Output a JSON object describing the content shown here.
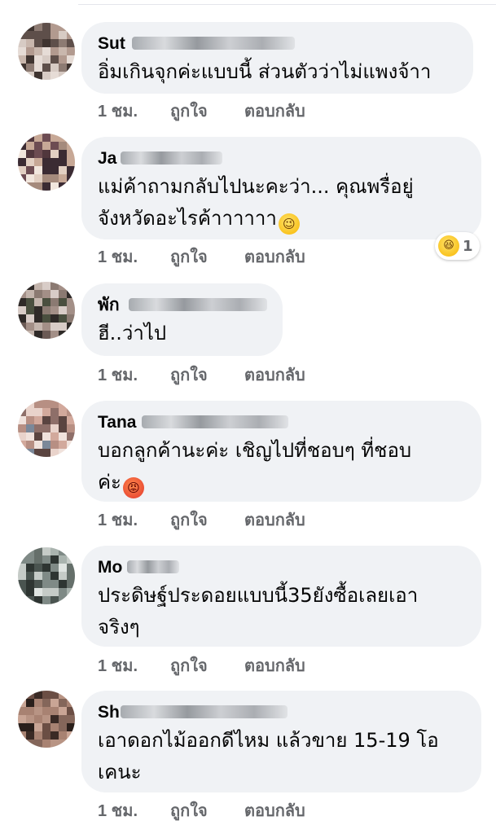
{
  "colors": {
    "bubble": "#f0f2f5",
    "action_text": "#65676b",
    "name_text": "#050505"
  },
  "action_labels": {
    "like": "ถูกใจ",
    "reply": "ตอบกลับ"
  },
  "comments": [
    {
      "name": "Sut",
      "text_lines": [
        "อิ่มเกินจุกค่ะแบบนี้ ส่วนตัวว่าไม่แพงจ้าา"
      ],
      "time": "1 ชม."
    },
    {
      "name": "Ja",
      "text_lines": [
        "แม่ค้าถามกลับไปนะคะว่า... คุณพรื่อยู่",
        "จังหวัดอะไรค้าาาาาา"
      ],
      "emoji": "wink-face-icon",
      "time": "1 ชม.",
      "reaction": {
        "icon": "laughing-face-icon",
        "count": "1"
      }
    },
    {
      "name": "พัก",
      "text_lines": [
        "ฮี..ว่าไป"
      ],
      "time": "1 ชม."
    },
    {
      "name": "Tana",
      "text_lines": [
        "บอกลูกค้านะค่ะ เชิญไปที่ชอบๆ ที่ชอบ",
        "ค่ะ"
      ],
      "emoji": "angry-face-icon",
      "time": "1 ชม."
    },
    {
      "name": "Mo",
      "text_lines": [
        "ประดิษฐ์ประดอยแบบนี้35ยังซื้อเลยเอา",
        "จริงๆ"
      ],
      "time": "1 ชม."
    },
    {
      "name": "Sh",
      "text_lines": [
        "เอาดอกไม้ออกดีไหม แล้วขาย 15-19 โอ",
        "เคนะ"
      ],
      "time": "1 ชม."
    }
  ]
}
